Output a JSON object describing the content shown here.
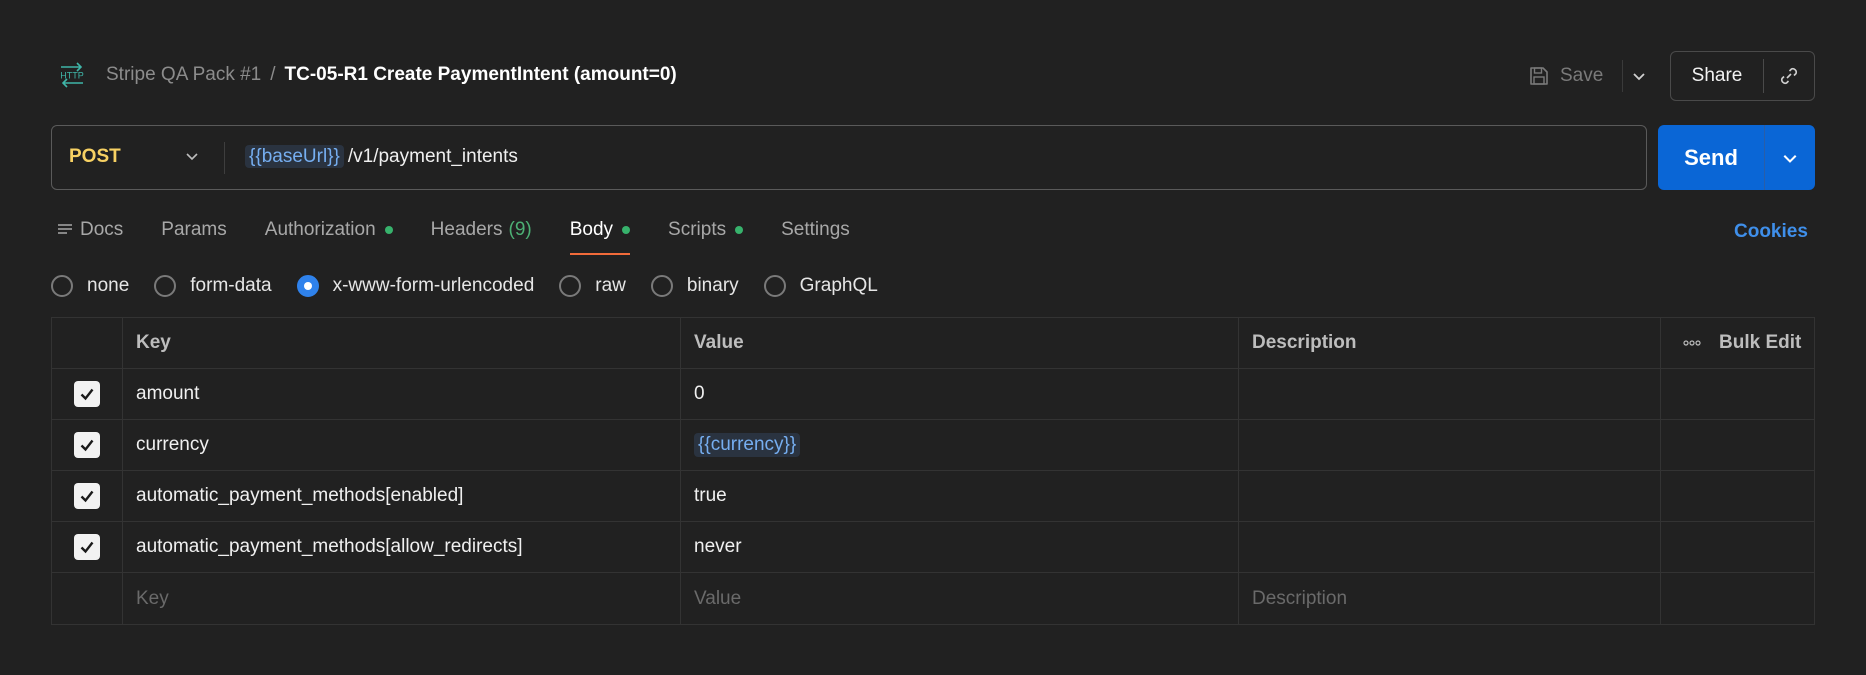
{
  "header": {
    "http_icon_label": "HTTP",
    "collection": "Stripe QA Pack #1",
    "separator": "/",
    "request_name": "TC-05-R1 Create PaymentIntent (amount=0)",
    "save_label": "Save",
    "share_label": "Share"
  },
  "request": {
    "method": "POST",
    "url_variable": "{{baseUrl}}",
    "url_path": "/v1/payment_intents",
    "send_label": "Send"
  },
  "tabs": [
    {
      "label": "Docs"
    },
    {
      "label": "Params"
    },
    {
      "label": "Authorization",
      "dot": true
    },
    {
      "label": "Headers",
      "count": "(9)"
    },
    {
      "label": "Body",
      "dot": true,
      "active": true
    },
    {
      "label": "Scripts",
      "dot": true
    },
    {
      "label": "Settings"
    }
  ],
  "cookies_label": "Cookies",
  "body_types": [
    {
      "label": "none",
      "selected": false
    },
    {
      "label": "form-data",
      "selected": false
    },
    {
      "label": "x-www-form-urlencoded",
      "selected": true
    },
    {
      "label": "raw",
      "selected": false
    },
    {
      "label": "binary",
      "selected": false
    },
    {
      "label": "GraphQL",
      "selected": false
    }
  ],
  "table": {
    "headers": {
      "key": "Key",
      "value": "Value",
      "description": "Description",
      "bulk_edit": "Bulk Edit"
    },
    "rows": [
      {
        "key": "amount",
        "value": "0",
        "checked": true
      },
      {
        "key": "currency",
        "value": "{{currency}}",
        "checked": true
      },
      {
        "key": "automatic_payment_methods[enabled]",
        "value": "true",
        "checked": true
      },
      {
        "key": "automatic_payment_methods[allow_redirects]",
        "value": "never",
        "checked": true
      }
    ],
    "placeholders": {
      "key": "Key",
      "value": "Value",
      "description": "Description"
    }
  },
  "colors": {
    "accent_blue": "#0a66d6",
    "method_yellow": "#f7d163",
    "active_tab_underline": "#f26b3a",
    "status_dot_green": "#37b26c",
    "variable_blue": "#76aef0"
  }
}
